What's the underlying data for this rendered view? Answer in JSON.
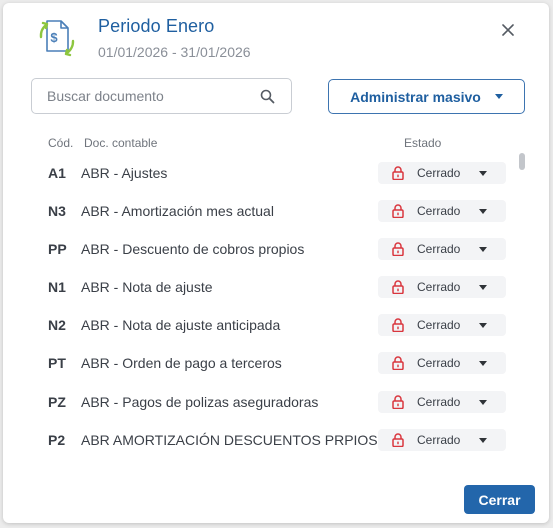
{
  "header": {
    "title": "Periodo Enero",
    "date_range": "01/01/2026 - 31/01/2026",
    "icon": "document-money-sync-icon"
  },
  "search": {
    "placeholder": "Buscar documento",
    "value": ""
  },
  "mass_button": {
    "label": "Administrar masivo"
  },
  "table": {
    "columns": {
      "cod": "Cód.",
      "doc": "Doc. contable",
      "estado": "Estado"
    },
    "rows": [
      {
        "cod": "A1",
        "doc": "ABR - Ajustes",
        "estado": "Cerrado"
      },
      {
        "cod": "N3",
        "doc": "ABR - Amortización mes actual",
        "estado": "Cerrado"
      },
      {
        "cod": "PP",
        "doc": "ABR - Descuento de cobros propios",
        "estado": "Cerrado"
      },
      {
        "cod": "N1",
        "doc": "ABR - Nota de ajuste",
        "estado": "Cerrado"
      },
      {
        "cod": "N2",
        "doc": "ABR - Nota de ajuste anticipada",
        "estado": "Cerrado"
      },
      {
        "cod": "PT",
        "doc": "ABR - Orden de pago a terceros",
        "estado": "Cerrado"
      },
      {
        "cod": "PZ",
        "doc": "ABR - Pagos de polizas aseguradoras",
        "estado": "Cerrado"
      },
      {
        "cod": "P2",
        "doc": "ABR AMORTIZACIÓN DESCUENTOS PRPIOS",
        "estado": "Cerrado"
      }
    ]
  },
  "footer": {
    "close_label": "Cerrar"
  },
  "colors": {
    "accent": "#2366ab",
    "title": "#1f5fa0",
    "lock": "#d9363e",
    "status_bg": "#f3f4f6"
  }
}
